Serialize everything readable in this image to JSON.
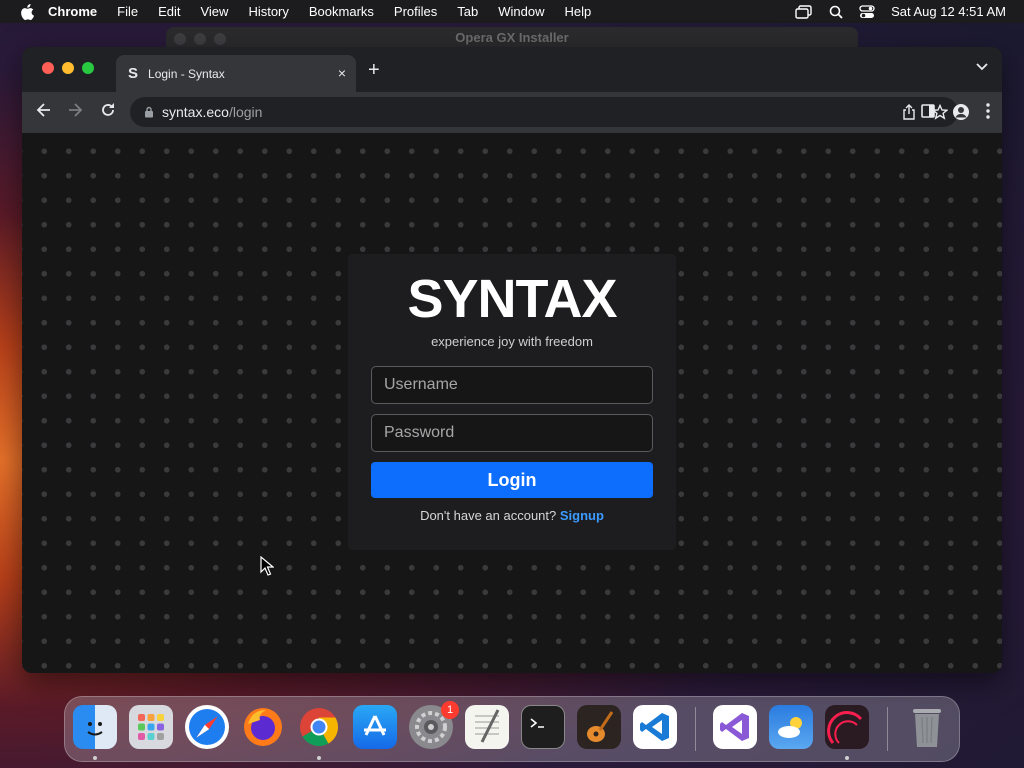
{
  "menubar": {
    "app_name": "Chrome",
    "menus": [
      "File",
      "Edit",
      "View",
      "History",
      "Bookmarks",
      "Profiles",
      "Tab",
      "Window",
      "Help"
    ],
    "clock": "Sat Aug 12  4:51 AM"
  },
  "background_window": {
    "title": "Opera GX Installer"
  },
  "browser": {
    "tab": {
      "favicon": "S",
      "title": "Login - Syntax",
      "close": "×"
    },
    "new_tab": "+",
    "url_host": "syntax.eco",
    "url_path": "/login"
  },
  "page": {
    "brand": "SYNTAX",
    "tagline": "experience joy with freedom",
    "username_placeholder": "Username",
    "password_placeholder": "Password",
    "login_label": "Login",
    "signup_prompt": "Don't have an account?",
    "signup_link": "Signup"
  },
  "dock": {
    "apps": [
      "Finder",
      "Launchpad",
      "Safari",
      "Firefox",
      "Chrome",
      "App Store",
      "System Settings",
      "TextEdit",
      "Terminal",
      "GarageBand",
      "Visual Studio Code",
      "Visual Studio",
      "Weather",
      "Opera GX",
      "Trash"
    ],
    "settings_badge": "1"
  },
  "colors": {
    "accent": "#0d6efd",
    "link": "#3b9bff",
    "card_bg": "#1d1d1f"
  }
}
